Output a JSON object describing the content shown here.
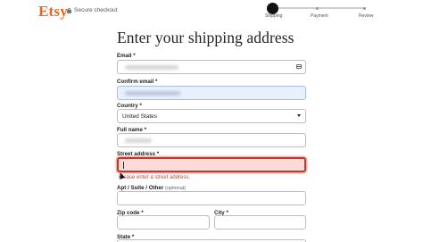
{
  "header": {
    "logo": "Etsy",
    "secure_label": "Secure checkout",
    "steps": [
      {
        "label": "Shipping",
        "state": "active"
      },
      {
        "label": "Payment",
        "state": "upcoming"
      },
      {
        "label": "Review",
        "state": "upcoming"
      }
    ]
  },
  "page_title": "Enter your shipping address",
  "form": {
    "email": {
      "label": "Email",
      "required": "*",
      "value": ""
    },
    "confirm_email": {
      "label": "Confirm email",
      "required": "*",
      "value": ""
    },
    "country": {
      "label": "Country",
      "required": "*",
      "value": "United States"
    },
    "full_name": {
      "label": "Full name",
      "required": "*",
      "value": ""
    },
    "street": {
      "label": "Street address",
      "required": "*",
      "value": "",
      "error": "Please enter a street address."
    },
    "apt": {
      "label": "Apt / Suite / Other",
      "optional": "(optional)",
      "value": ""
    },
    "zip": {
      "label": "Zip code",
      "required": "*",
      "value": ""
    },
    "city": {
      "label": "City",
      "required": "*",
      "value": ""
    },
    "state": {
      "label": "State",
      "required": "*"
    }
  },
  "colors": {
    "brand": "#f1641e",
    "error": "#c0392b",
    "error_bg": "#fdd9d7",
    "autofill_bg": "#e8f0fe"
  }
}
